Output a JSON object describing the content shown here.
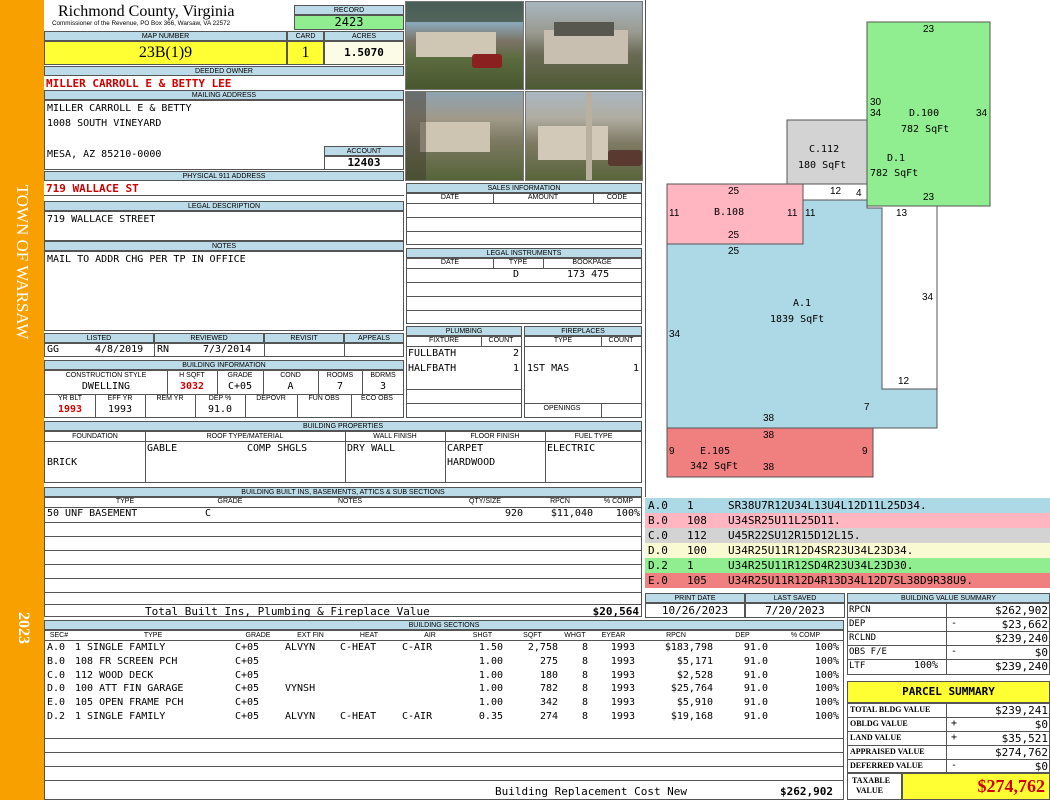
{
  "side": {
    "town": "TOWN OF WARSAW",
    "year": "2023"
  },
  "header": {
    "county": "Richmond County, Virginia",
    "commissioner": "Commissioner of the Revenue, PO Box 366, Warsaw, VA 22572",
    "record_label": "RECORD",
    "record": "2423",
    "map_label": "MAP NUMBER",
    "map": "23B(1)9",
    "card_label": "CARD",
    "card": "1",
    "acres_label": "ACRES",
    "acres": "1.5070"
  },
  "owner": {
    "label": "DEEDED OWNER",
    "name": "MILLER CARROLL E & BETTY LEE",
    "mail_label": "MAILING ADDRESS",
    "mail1": "MILLER CARROLL E & BETTY",
    "mail2": "1008 SOUTH VINEYARD",
    "mail3": "MESA, AZ 85210-0000",
    "account_label": "ACCOUNT",
    "account": "12403"
  },
  "physical": {
    "label": "PHYSICAL 911 ADDRESS",
    "address": "719 WALLACE ST"
  },
  "legal": {
    "label": "LEGAL DESCRIPTION",
    "text": "719 WALLACE STREET"
  },
  "notes": {
    "label": "NOTES",
    "text": "MAIL TO ADDR CHG PER TP IN OFFICE"
  },
  "review": {
    "listed_label": "LISTED",
    "reviewed_label": "REVIEWED",
    "revisit_label": "REVISIT",
    "appeals_label": "APPEALS",
    "listed_by": "GG",
    "listed_date": "4/8/2019",
    "reviewed_by": "RN",
    "reviewed_date": "7/3/2014"
  },
  "building_info": {
    "label": "BUILDING INFORMATION",
    "h": [
      "CONSTRUCTION STYLE",
      "H SQFT",
      "GRADE",
      "COND",
      "ROOMS",
      "BDRMS"
    ],
    "v": [
      "DWELLING",
      "3032",
      "C+05",
      "A",
      "7",
      "3"
    ],
    "h2": [
      "YR BLT",
      "EFF YR",
      "REM YR",
      "DEP %",
      "DEPOVR",
      "FUN OBS",
      "ECO OBS"
    ],
    "v2": [
      "1993",
      "1993",
      "",
      "91.0",
      "",
      "",
      ""
    ]
  },
  "properties": {
    "label": "BUILDING PROPERTIES",
    "h": [
      "FOUNDATION",
      "ROOF TYPE/MATERIAL",
      "WALL FINISH",
      "FLOOR FINISH",
      "FUEL TYPE"
    ],
    "foundation": "BRICK",
    "roof1": "GABLE",
    "roof2": "COMP SHGLS",
    "wall": "DRY WALL",
    "floor1": "CARPET",
    "floor2": "HARDWOOD",
    "fuel": "ELECTRIC"
  },
  "builtins": {
    "label": "BUILDING BUILT INS, BASEMENTS, ATTICS & SUB SECTIONS",
    "h": [
      "TYPE",
      "GRADE",
      "NOTES",
      "QTY/SIZE",
      "RPCN",
      "% COMP"
    ],
    "rows": [
      {
        "type": "50 UNF BASEMENT",
        "grade": "C",
        "notes": "",
        "qty": "920",
        "rpcn": "$11,040",
        "comp": "100%"
      }
    ],
    "total_label": "Total Built Ins, Plumbing & Fireplace Value",
    "total": "$20,564"
  },
  "sales": {
    "label": "SALES INFORMATION",
    "h": [
      "DATE",
      "AMOUNT",
      "CODE"
    ]
  },
  "legal_inst": {
    "label": "LEGAL INSTRUMENTS",
    "h": [
      "DATE",
      "TYPE",
      "BOOKPAGE"
    ],
    "type": "D",
    "book": "173 475"
  },
  "plumbing": {
    "label": "PLUMBING",
    "h": [
      "FIXTURE",
      "COUNT"
    ],
    "rows": [
      {
        "f": "FULLBATH",
        "c": "2"
      },
      {
        "f": "HALFBATH",
        "c": "1"
      }
    ]
  },
  "fireplaces": {
    "label": "FIREPLACES",
    "h": [
      "TYPE",
      "COUNT"
    ],
    "rows": [
      {
        "t": "1ST MAS",
        "c": "1"
      }
    ],
    "openings_label": "OPENINGS"
  },
  "sketch": {
    "labels": {
      "A": "A.1",
      "A_sq": "1839 SqFt",
      "B": "B.108",
      "C": "C.112",
      "C_sq": "180 SqFt",
      "D100": "D.100",
      "D100_sq": "782 SqFt",
      "D1": "D.1",
      "D1_sq": "782 SqFt",
      "E": "E.105",
      "E_sq": "342 SqFt"
    },
    "dims": {
      "d23t": "23",
      "d30": "30",
      "d34a": "34",
      "d34b": "34",
      "d25a": "25",
      "d12a": "12",
      "d4": "4",
      "d23b": "23",
      "d11a": "11",
      "d11b": "11",
      "d11c": "11",
      "d13": "13",
      "d25b": "25",
      "d25c": "25",
      "d34c": "34",
      "d34d": "34",
      "d12b": "12",
      "d7": "7",
      "d38a": "38",
      "d38b": "38",
      "d9a": "9",
      "d9b": "9",
      "d38c": "38"
    },
    "colors": {
      "A": "#add8e6",
      "B": "#ffb6c1",
      "C": "#d3d3d3",
      "D": "#90ee90",
      "E": "#f08080"
    }
  },
  "segments": [
    {
      "code": "A.0",
      "num": "1",
      "vec": "SR38U7R12U34L13U4L12D11L25D34.",
      "color": "#add8e6"
    },
    {
      "code": "B.0",
      "num": "108",
      "vec": "U34SR25U11L25D11.",
      "color": "#ffb6c1"
    },
    {
      "code": "C.0",
      "num": "112",
      "vec": "U45R22SU12R15D12L15.",
      "color": "#d3d3d3"
    },
    {
      "code": "D.0",
      "num": "100",
      "vec": "U34R25U11R12D4SR23U34L23D34.",
      "color": "#fafad2"
    },
    {
      "code": "D.2",
      "num": "1",
      "vec": "U34R25U11R12SD4R23U34L23D30.",
      "color": "#90ee90"
    },
    {
      "code": "E.0",
      "num": "105",
      "vec": "U34R25U11R12D4R13D34L12D7SL38D9R38U9.",
      "color": "#f08080"
    }
  ],
  "dates": {
    "print_label": "PRINT DATE",
    "saved_label": "LAST SAVED",
    "print": "10/26/2023",
    "saved": "7/20/2023"
  },
  "sections": {
    "label": "BUILDING SECTIONS",
    "h": [
      "SEC#",
      "TYPE",
      "GRADE",
      "EXT FIN",
      "HEAT",
      "AIR",
      "SHGT",
      "SQFT",
      "WHGT",
      "EYEAR",
      "RPCN",
      "DEP",
      "% COMP"
    ],
    "rows": [
      [
        "A.0",
        "1 SINGLE FAMILY",
        "C+05",
        "ALVYN",
        "C-HEAT",
        "C-AIR",
        "1.50",
        "2,758",
        "8",
        "1993",
        "$183,798",
        "91.0",
        "100%"
      ],
      [
        "B.0",
        "108 FR SCREEN PCH",
        "C+05",
        "",
        "",
        "",
        "1.00",
        "275",
        "8",
        "1993",
        "$5,171",
        "91.0",
        "100%"
      ],
      [
        "C.0",
        "112 WOOD DECK",
        "C+05",
        "",
        "",
        "",
        "1.00",
        "180",
        "8",
        "1993",
        "$2,528",
        "91.0",
        "100%"
      ],
      [
        "D.0",
        "100 ATT FIN GARAGE",
        "C+05",
        "VYNSH",
        "",
        "",
        "1.00",
        "782",
        "8",
        "1993",
        "$25,764",
        "91.0",
        "100%"
      ],
      [
        "E.0",
        "105 OPEN FRAME PCH",
        "C+05",
        "",
        "",
        "",
        "1.00",
        "342",
        "8",
        "1993",
        "$5,910",
        "91.0",
        "100%"
      ],
      [
        "D.2",
        "1 SINGLE FAMILY",
        "C+05",
        "ALVYN",
        "C-HEAT",
        "C-AIR",
        "0.35",
        "274",
        "8",
        "1993",
        "$19,168",
        "91.0",
        "100%"
      ]
    ],
    "total_label": "Building Replacement Cost New",
    "total": "$262,902"
  },
  "value_summary": {
    "label": "BUILDING VALUE SUMMARY",
    "rows": [
      {
        "k": "RPCN",
        "s": "",
        "v": "$262,902"
      },
      {
        "k": "DEP",
        "s": "-",
        "v": "$23,662"
      },
      {
        "k": "RCLND",
        "s": "",
        "v": "$239,240"
      },
      {
        "k": "OBS F/E",
        "s": "-",
        "v": "$0"
      },
      {
        "k": "LTF",
        "p": "100%",
        "s": "",
        "v": "$239,240"
      }
    ]
  },
  "parcel": {
    "label": "PARCEL SUMMARY",
    "rows": [
      {
        "k": "TOTAL BLDG VALUE",
        "s": "",
        "v": "$239,241"
      },
      {
        "k": "OBLDG VALUE",
        "s": "+",
        "v": "$0"
      },
      {
        "k": "LAND VALUE",
        "s": "+",
        "v": "$35,521"
      },
      {
        "k": "APPRAISED VALUE",
        "s": "",
        "v": "$274,762"
      },
      {
        "k": "DEFERRED VALUE",
        "s": "-",
        "v": "$0"
      }
    ],
    "taxable_label1": "TAXABLE",
    "taxable_label2": "VALUE",
    "taxable": "$274,762"
  }
}
